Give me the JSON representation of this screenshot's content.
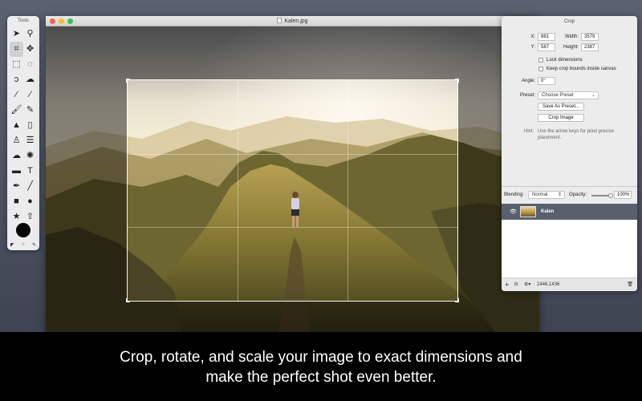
{
  "tools": {
    "title": "Tools",
    "items": [
      {
        "icon": "arrow-select-icon",
        "glyph": "➤",
        "selected": false
      },
      {
        "icon": "zoom-icon",
        "glyph": "⚲",
        "selected": false
      },
      {
        "icon": "crop-icon",
        "glyph": "⌗",
        "selected": true
      },
      {
        "icon": "transform-icon",
        "glyph": "✥",
        "selected": false
      },
      {
        "icon": "rect-select-icon",
        "glyph": "⬚",
        "selected": false
      },
      {
        "icon": "ellipse-select-icon",
        "glyph": "◌",
        "selected": false
      },
      {
        "icon": "lasso-icon",
        "glyph": "ↄ",
        "selected": false
      },
      {
        "icon": "polygon-lasso-icon",
        "glyph": "☁",
        "selected": false
      },
      {
        "icon": "magic-wand-icon",
        "glyph": "⁄",
        "selected": false
      },
      {
        "icon": "quick-select-icon",
        "glyph": "⁄",
        "selected": false
      },
      {
        "icon": "brush-icon",
        "glyph": "🖌",
        "selected": false
      },
      {
        "icon": "pencil-icon",
        "glyph": "✎",
        "selected": false
      },
      {
        "icon": "paint-bucket-icon",
        "glyph": "▲",
        "selected": false
      },
      {
        "icon": "eraser-icon",
        "glyph": "▯",
        "selected": false
      },
      {
        "icon": "stamp-icon",
        "glyph": "♙",
        "selected": false
      },
      {
        "icon": "smudge-icon",
        "glyph": "☰",
        "selected": false
      },
      {
        "icon": "cloud-icon",
        "glyph": "☁",
        "selected": false
      },
      {
        "icon": "sun-icon",
        "glyph": "✺",
        "selected": false
      },
      {
        "icon": "gradient-icon",
        "glyph": "▬",
        "selected": false
      },
      {
        "icon": "text-icon",
        "glyph": "T",
        "selected": false
      },
      {
        "icon": "pen-icon",
        "glyph": "✒",
        "selected": false
      },
      {
        "icon": "line-icon",
        "glyph": "╱",
        "selected": false
      },
      {
        "icon": "rectangle-shape-icon",
        "glyph": "■",
        "selected": false
      },
      {
        "icon": "oval-shape-icon",
        "glyph": "●",
        "selected": false
      },
      {
        "icon": "star-shape-icon",
        "glyph": "★",
        "selected": false
      },
      {
        "icon": "arrow-shape-icon",
        "glyph": "⇧",
        "selected": false
      }
    ],
    "foreground_color": "#000000",
    "footer_glyphs": [
      "◤",
      "○",
      "✎"
    ]
  },
  "window": {
    "title": "Kalen.jpg"
  },
  "crop_panel": {
    "title": "Crop",
    "x_label": "X:",
    "x_value": "881",
    "y_label": "Y:",
    "y_value": "587",
    "width_label": "Width:",
    "width_value": "3579",
    "height_label": "Height:",
    "height_value": "2387",
    "lock_dimensions": "Lock dimensions",
    "keep_bounds": "Keep crop bounds inside canvas",
    "angle_label": "Angle:",
    "angle_value": "0°",
    "preset_label": "Preset:",
    "preset_value": "Choose Preset",
    "save_preset": "Save As Preset...",
    "crop_image": "Crop Image",
    "hint_label": "Hint:",
    "hint_text": "Use the arrow keys for pixel precise placement."
  },
  "layers": {
    "blending_label": "Blending:",
    "blending_value": "Normal",
    "opacity_label": "Opacity:",
    "opacity_value": "100%",
    "opacity_fraction": 1.0,
    "layer_name": "Kalen",
    "footer_add": "+",
    "footer_fx": "fx",
    "footer_gear": "⚙▾",
    "footer_size": "2446,1436",
    "footer_trash": "🗑"
  },
  "caption": {
    "line1": "Crop, rotate, and scale your image to exact dimensions and",
    "line2": "make the perfect shot even better."
  }
}
